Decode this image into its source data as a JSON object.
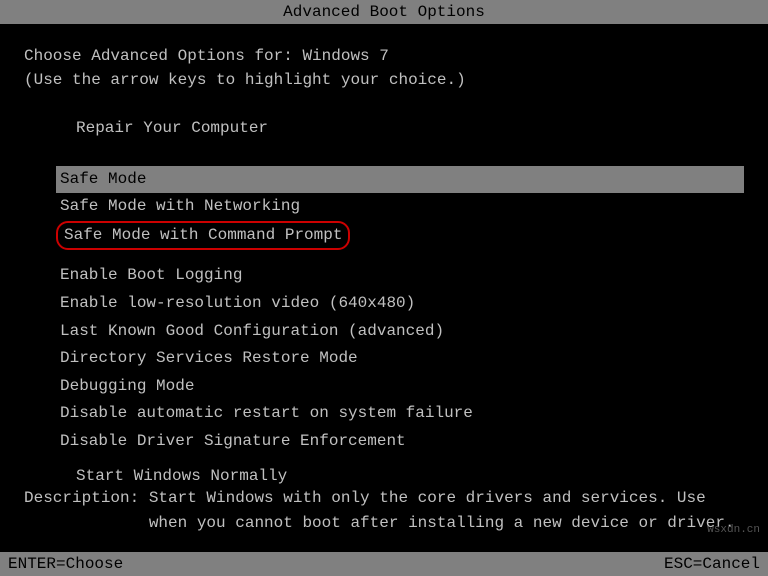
{
  "title_bar": {
    "text": "Advanced Boot Options"
  },
  "header": {
    "line1": "Choose Advanced Options for: Windows 7",
    "line2": "(Use the arrow keys to highlight your choice.)"
  },
  "repair": {
    "label": "Repair Your Computer"
  },
  "menu_items": [
    {
      "id": "safe-mode",
      "label": "Safe Mode",
      "selected": true,
      "circled": false
    },
    {
      "id": "safe-mode-networking",
      "label": "Safe Mode with Networking",
      "selected": false,
      "circled": false
    },
    {
      "id": "safe-mode-command-prompt",
      "label": "Safe Mode with Command Prompt",
      "selected": false,
      "circled": true
    },
    {
      "id": "enable-boot-logging",
      "label": "Enable Boot Logging",
      "selected": false,
      "circled": false
    },
    {
      "id": "enable-low-res",
      "label": "Enable low-resolution video (640x480)",
      "selected": false,
      "circled": false
    },
    {
      "id": "last-known-good",
      "label": "Last Known Good Configuration (advanced)",
      "selected": false,
      "circled": false
    },
    {
      "id": "directory-services",
      "label": "Directory Services Restore Mode",
      "selected": false,
      "circled": false
    },
    {
      "id": "debugging-mode",
      "label": "Debugging Mode",
      "selected": false,
      "circled": false
    },
    {
      "id": "disable-restart",
      "label": "Disable automatic restart on system failure",
      "selected": false,
      "circled": false
    },
    {
      "id": "disable-driver-sig",
      "label": "Disable Driver Signature Enforcement",
      "selected": false,
      "circled": false
    }
  ],
  "start_normally": {
    "label": "Start Windows Normally"
  },
  "description": {
    "line1": "Description: Start Windows with only the core drivers and services. Use",
    "line2": "             when you cannot boot after installing a new device or driver."
  },
  "bottom_bar": {
    "enter_label": "ENTER=Choose",
    "esc_label": "ESC=Cancel"
  },
  "watermark": "wsxdn.cn"
}
